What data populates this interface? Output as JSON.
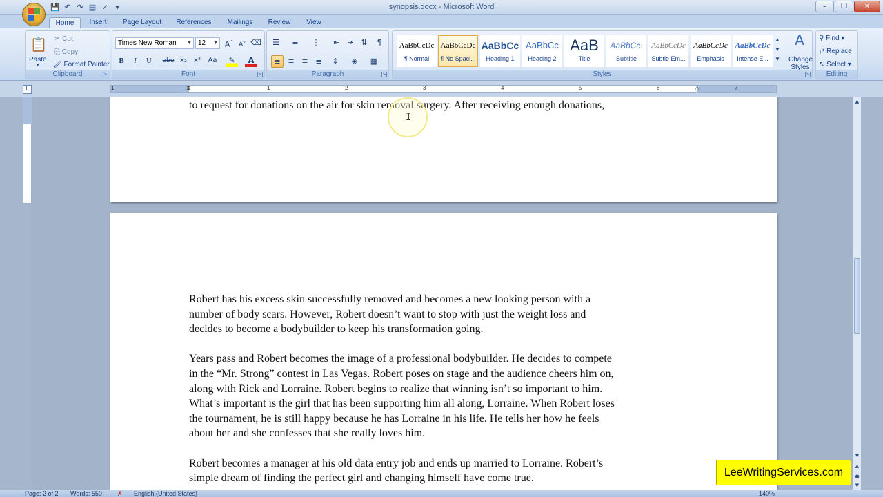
{
  "window": {
    "title": "synopsis.docx - Microsoft Word",
    "controls": [
      "minimize",
      "restore",
      "close"
    ]
  },
  "quick_access": [
    "save-icon",
    "undo-icon",
    "redo-icon",
    "print-preview-icon",
    "spelling-icon"
  ],
  "tabs": [
    {
      "label": "Home",
      "active": true
    },
    {
      "label": "Insert"
    },
    {
      "label": "Page Layout"
    },
    {
      "label": "References"
    },
    {
      "label": "Mailings"
    },
    {
      "label": "Review"
    },
    {
      "label": "View"
    }
  ],
  "ribbon": {
    "clipboard": {
      "label": "Clipboard",
      "paste": "Paste",
      "cut": "Cut",
      "copy": "Copy",
      "format_painter": "Format Painter"
    },
    "font": {
      "label": "Font",
      "family": "Times New Roman",
      "size": "12",
      "buttons": [
        "B",
        "I",
        "U",
        "abe",
        "x₂",
        "x²",
        "Aa"
      ]
    },
    "paragraph": {
      "label": "Paragraph"
    },
    "styles": {
      "label": "Styles",
      "tiles": [
        {
          "sample": "AaBbCcDc",
          "name": "¶ Normal"
        },
        {
          "sample": "AaBbCcDc",
          "name": "¶ No Spaci...",
          "selected": true
        },
        {
          "sample": "AaBbCc",
          "name": "Heading 1"
        },
        {
          "sample": "AaBbCc",
          "name": "Heading 2"
        },
        {
          "sample": "AaB",
          "name": "Title"
        },
        {
          "sample": "AaBbCc.",
          "name": "Subtitle"
        },
        {
          "sample": "AaBbCcDc",
          "name": "Subtle Em..."
        },
        {
          "sample": "AaBbCcDc",
          "name": "Emphasis"
        },
        {
          "sample": "AaBbCcDc",
          "name": "Intense E..."
        }
      ],
      "change_styles": "Change Styles"
    },
    "editing": {
      "label": "Editing",
      "find": "Find",
      "replace": "Replace",
      "select": "Select"
    }
  },
  "ruler": {
    "numbers": [
      "1",
      "1",
      "2",
      "3",
      "4",
      "5",
      "6",
      "7"
    ]
  },
  "document": {
    "page1_last_line": "to request for donations on the air for skin removal surgery. After receiving enough donations,",
    "paragraphs": [
      "Robert has his excess skin successfully removed and becomes a new looking person with a\nnumber of body scars. However, Robert doesn’t want to stop with just the weight loss and\ndecides to become a bodybuilder to keep his transformation going.",
      "Years pass and Robert becomes the image of a professional bodybuilder. He decides to compete\nin the “Mr. Strong” contest in Las Vegas. Robert poses on stage and the audience cheers him on,\nalong with Rick and Lorraine. Robert begins to realize that winning isn’t so important to him.\nWhat’s important is the girl that has been supporting him all along, Lorraine. When Robert loses\nthe tournament, he is still happy because he has Lorraine in his life. He tells her how he feels\nabout her and she confesses that she really loves him.",
      "Robert becomes a manager at his old data entry job and ends up married to Lorraine. Robert’s\nsimple dream of finding the perfect girl and changing himself have come true."
    ]
  },
  "status_bar": {
    "page": "Page: 2 of 2",
    "words": "Words: 550",
    "language": "English (United States)",
    "zoom": "140%"
  },
  "watermark": "LeeWritingServices.com",
  "colors": {
    "ribbon_bg": "#d1e0f3",
    "doc_bg": "#a3b3c9",
    "watermark_bg": "#ffff00"
  }
}
